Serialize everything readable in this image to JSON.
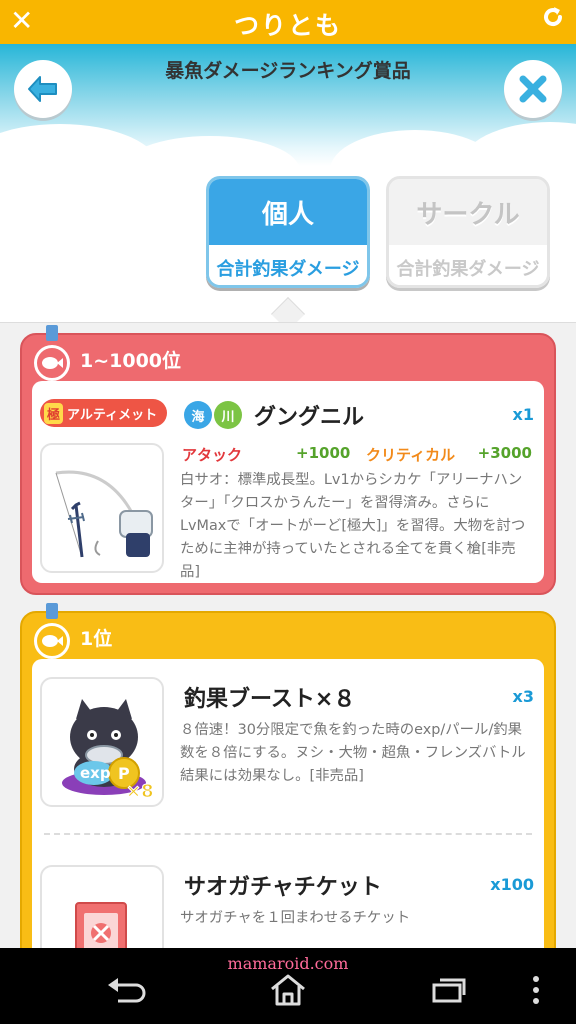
{
  "app": {
    "title": "つりとも"
  },
  "header": {
    "subtitle": "暴魚ダメージランキング賞品"
  },
  "tabs": [
    {
      "label": "個人",
      "sublabel": "合計釣果ダメージ",
      "active": true
    },
    {
      "label": "サークル",
      "sublabel": "合計釣果ダメージ",
      "active": false
    }
  ],
  "rewards": [
    {
      "rank": "1~1000位",
      "color": "#ee6a6f",
      "items": [
        {
          "rarity_kanji": "極",
          "rarity_label": "アルティメット",
          "attributes": [
            "海",
            "川"
          ],
          "name": "グングニル",
          "qty": "x1",
          "stat1_label": "アタック",
          "stat1_value": "+1000",
          "stat2_label": "クリティカル",
          "stat2_value": "+3000",
          "description": "白サオ：標準成長型。Lv1からシカケ「アリーナハンター」「クロスかうんたー」を習得済み。さらにLvMaxで「オートがーど[極大]」を習得。大物を討つために主神が持っていたとされる全てを貫く槍[非売品]"
        }
      ]
    },
    {
      "rank": "1位",
      "color": "#f9bd15",
      "items": [
        {
          "name": "釣果ブースト×８",
          "qty": "x3",
          "thumb_text_exp": "exp",
          "thumb_text_p": "P",
          "thumb_text_mult": "×8",
          "description": "８倍速！30分限定で魚を釣った時のexp/パール/釣果数を８倍にする。ヌシ・大物・超魚・フレンズバトル結果には効果なし。[非売品]"
        },
        {
          "name": "サオガチャチケット",
          "qty": "x100",
          "description": "サオガチャを１回まわせるチケット"
        }
      ]
    }
  ],
  "watermark": "mamaroid.com",
  "icons": [
    "close-icon",
    "reload-icon",
    "back-arrow-icon",
    "close-icon",
    "fish-medal-icon",
    "back-nav-icon",
    "home-nav-icon",
    "recent-apps-icon",
    "overflow-menu-icon"
  ]
}
